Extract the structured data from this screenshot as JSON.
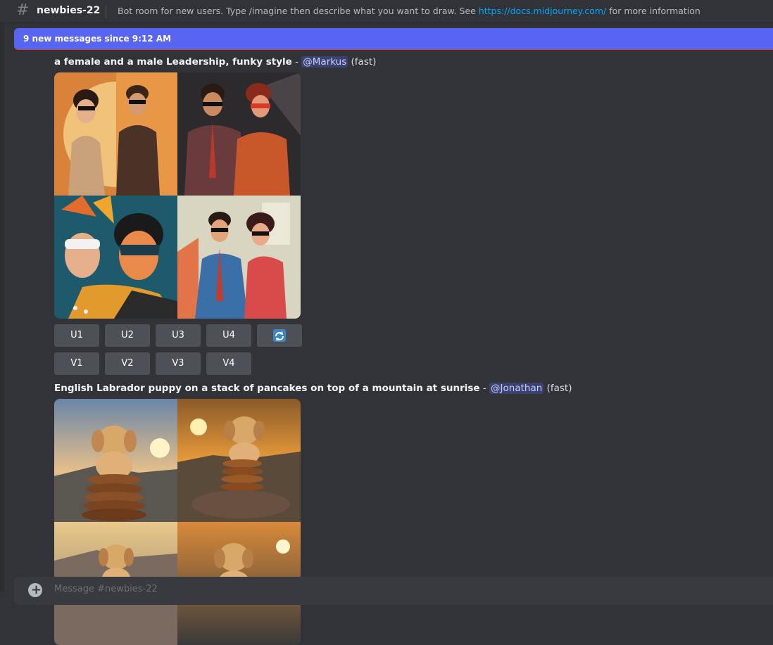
{
  "header": {
    "channel": "newbies-22",
    "topic_text": "Bot room for new users. Type /imagine then describe what you want to draw. See ",
    "topic_link": "https://docs.midjourney.com/",
    "topic_suffix": " for more information"
  },
  "banner": {
    "text": "9 new messages since 9:12 AM"
  },
  "messages": [
    {
      "prompt": "a female and a male Leadership, funky style",
      "separator": " - ",
      "mention": "@Markus",
      "mode": " (fast)",
      "buttons_row1": [
        "U1",
        "U2",
        "U3",
        "U4"
      ],
      "buttons_row2": [
        "V1",
        "V2",
        "V3",
        "V4"
      ],
      "refresh_icon": "refresh-icon"
    },
    {
      "prompt": "English Labrador puppy on a stack of pancakes on top of a mountain at sunrise",
      "separator": " - ",
      "mention": "@Jonathan",
      "mode": " (fast)"
    }
  ],
  "composer": {
    "placeholder": "Message #newbies-22"
  },
  "colors": {
    "background": "#313338",
    "banner": "#5865f2",
    "button": "#4e5058",
    "link": "#00a8fc",
    "mention_bg": "#3c4270"
  }
}
